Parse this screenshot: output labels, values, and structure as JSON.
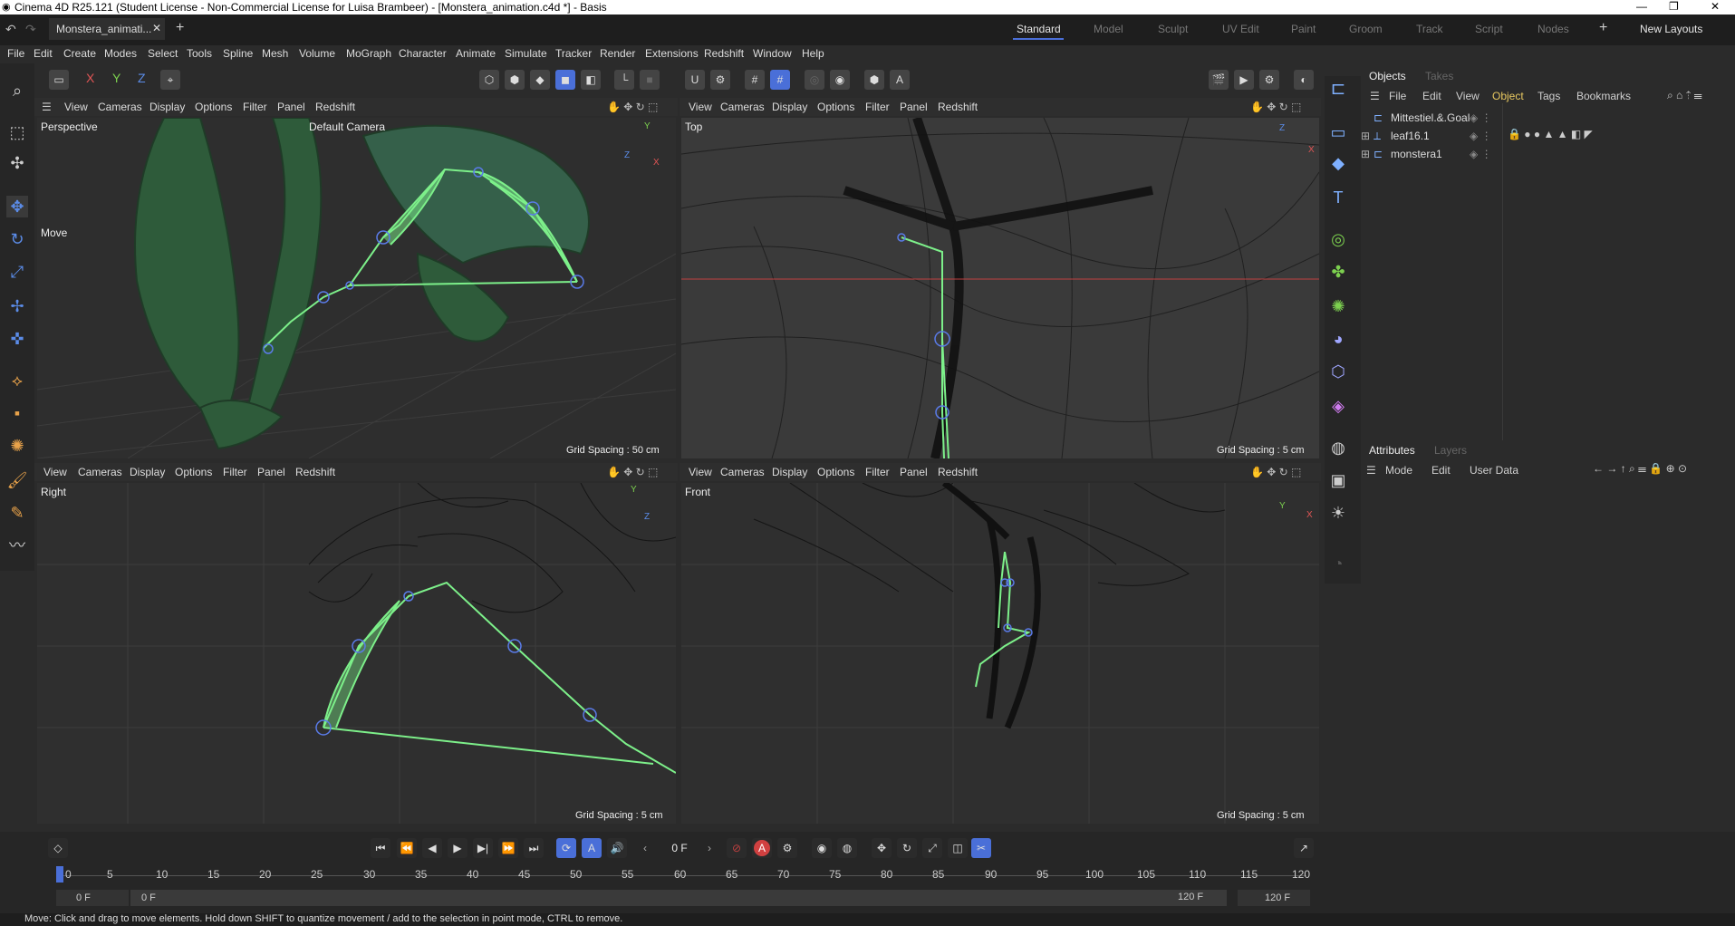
{
  "window_title": "Cinema 4D R25.121 (Student License - Non-Commercial License for Luisa Brambeer) - [Monstera_animation.c4d *] - Basis",
  "doc_tab": "Monstera_animati...",
  "layouts": [
    "Standard",
    "Model",
    "Sculpt",
    "UV Edit",
    "Paint",
    "Groom",
    "Track",
    "Script",
    "Nodes"
  ],
  "new_layouts": "New Layouts",
  "menu": [
    "File",
    "Edit",
    "Create",
    "Modes",
    "Select",
    "Tools",
    "Spline",
    "Mesh",
    "Volume",
    "MoGraph",
    "Character",
    "Animate",
    "Simulate",
    "Tracker",
    "Render",
    "Extensions",
    "Redshift",
    "Window",
    "Help"
  ],
  "axis_buttons": [
    "X",
    "Y",
    "Z"
  ],
  "vp_menu": [
    "View",
    "Cameras",
    "Display",
    "Options",
    "Filter",
    "Panel",
    "Redshift"
  ],
  "viewports": {
    "perspective": {
      "name": "Perspective",
      "camera": "Default Camera",
      "grid": "Grid Spacing : 50 cm",
      "hint": "Move"
    },
    "top": {
      "name": "Top",
      "grid": "Grid Spacing : 5 cm"
    },
    "right": {
      "name": "Right",
      "grid": "Grid Spacing : 5 cm"
    },
    "front": {
      "name": "Front",
      "grid": "Grid Spacing : 5 cm"
    }
  },
  "objects_panel": {
    "tabs": [
      "Objects",
      "Takes"
    ],
    "menu": [
      "File",
      "Edit",
      "View",
      "Object",
      "Tags",
      "Bookmarks"
    ],
    "items": [
      "Mittestiel.&.Goal",
      "leaf16.1",
      "monstera1"
    ]
  },
  "attributes_panel": {
    "tabs": [
      "Attributes",
      "Layers"
    ],
    "menu": [
      "Mode",
      "Edit",
      "User Data"
    ]
  },
  "timeline": {
    "current": "0 F",
    "ticks": [
      "0",
      "5",
      "10",
      "15",
      "20",
      "25",
      "30",
      "35",
      "40",
      "45",
      "50",
      "55",
      "60",
      "65",
      "70",
      "75",
      "80",
      "85",
      "90",
      "95",
      "100",
      "105",
      "110",
      "115",
      "120"
    ],
    "start": "0 F",
    "start2": "0 F",
    "end": "120 F",
    "end2": "120 F"
  },
  "status": "Move: Click and drag to move elements. Hold down SHIFT to quantize movement / add to the selection in point mode, CTRL to remove.",
  "colors": {
    "accent": "#4a6fd8",
    "bone": "#7df08a"
  }
}
